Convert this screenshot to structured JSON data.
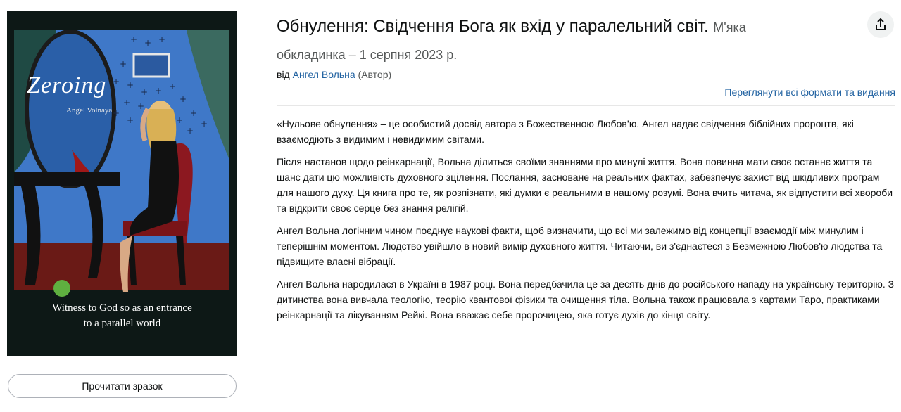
{
  "product": {
    "title": "Обнулення: Свідчення Бога як вхід у паралельний світ.",
    "binding": "М'яка",
    "binding_rest": "обкладинка",
    "date_sep": " – ",
    "date": "1 серпня 2023 р.",
    "by_label": "від",
    "author": "Ангел Вольна",
    "author_role": "(Автор)",
    "formats_link": "Переглянути всі формати та видання",
    "share_icon": "share-icon"
  },
  "cover": {
    "title": "Zeroing",
    "author": "Angel Volnaya",
    "subtitle_line1": "Witness to God so as an entrance",
    "subtitle_line2": "to a parallel world"
  },
  "sample_button": "Прочитати зразок",
  "description": [
    "«Нульове обнулення» – це особистий досвід автора з Божественною Любов’ю. Ангел надає свідчення біблійних пророцтв, які взаємодіють з видимим і невидимим світами.",
    "Після настанов щодо реінкарнації, Вольна ділиться своїми знаннями про минулі життя. Вона повинна мати своє останнє життя та шанс дати цю можливість духовного зцілення. Послання, засноване на реальних фактах, забезпечує захист від шкідливих програм для нашого духу. Ця книга про те, як розпізнати, які думки є реальними в нашому розумі. Вона вчить читача, як відпустити всі хвороби та відкрити своє серце без знання релігій.",
    "Ангел Вольна логічним чином поєднує наукові факти, щоб визначити, що всі ми залежимо від концепції взаємодії між минулим і теперішнім моментом. Людство увійшло в новий вимір духовного життя. Читаючи, ви з'єднаєтеся з Безмежною Любов'ю людства та підвищите власні вібрації.",
    "Ангел Вольна народилася в Україні в 1987 році. Вона передбачила це за десять днів до російського нападу на українську територію. З дитинства вона вивчала теологію, теорію квантової фізики та очищення тіла. Вольна також працювала з картами Таро, практиками реінкарнації та лікуванням Рейкі. Вона вважає себе пророчицею, яка готує духів до кінця світу."
  ],
  "colors": {
    "link": "#2162a1",
    "muted": "#565959",
    "text": "#0f1111"
  }
}
